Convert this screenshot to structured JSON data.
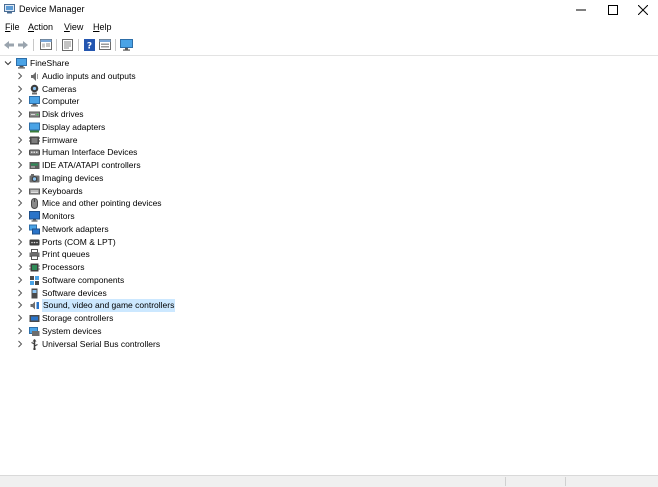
{
  "window": {
    "title": "Device Manager"
  },
  "menu": [
    {
      "label_u": "F",
      "label_rest": "ile"
    },
    {
      "label_u": "A",
      "label_rest": "ction"
    },
    {
      "label_u": "V",
      "label_rest": "iew"
    },
    {
      "label_u": "H",
      "label_rest": "elp"
    }
  ],
  "toolbar": {
    "buttons": [
      "back-arrow-icon",
      "forward-arrow-icon",
      "properties-icon",
      "update-driver-icon",
      "help-icon",
      "show-hidden-icon",
      "computer-monitor-icon"
    ]
  },
  "tree": {
    "root": {
      "label": "FineShare",
      "expanded": true
    },
    "items": [
      {
        "label": "Audio inputs and outputs",
        "icon": "speaker-icon"
      },
      {
        "label": "Cameras",
        "icon": "camera-icon"
      },
      {
        "label": "Computer",
        "icon": "computer-icon"
      },
      {
        "label": "Disk drives",
        "icon": "disk-drive-icon"
      },
      {
        "label": "Display adapters",
        "icon": "display-adapter-icon"
      },
      {
        "label": "Firmware",
        "icon": "firmware-icon"
      },
      {
        "label": "Human Interface Devices",
        "icon": "hid-icon"
      },
      {
        "label": "IDE ATA/ATAPI controllers",
        "icon": "ide-controller-icon"
      },
      {
        "label": "Imaging devices",
        "icon": "imaging-icon"
      },
      {
        "label": "Keyboards",
        "icon": "keyboard-icon"
      },
      {
        "label": "Mice and other pointing devices",
        "icon": "mouse-icon"
      },
      {
        "label": "Monitors",
        "icon": "monitor-icon"
      },
      {
        "label": "Network adapters",
        "icon": "network-adapter-icon"
      },
      {
        "label": "Ports (COM & LPT)",
        "icon": "port-icon"
      },
      {
        "label": "Print queues",
        "icon": "printer-icon"
      },
      {
        "label": "Processors",
        "icon": "processor-icon"
      },
      {
        "label": "Software components",
        "icon": "software-component-icon"
      },
      {
        "label": "Software devices",
        "icon": "software-device-icon"
      },
      {
        "label": "Sound, video and game controllers",
        "icon": "sound-controller-icon",
        "selected": true
      },
      {
        "label": "Storage controllers",
        "icon": "storage-controller-icon"
      },
      {
        "label": "System devices",
        "icon": "system-device-icon"
      },
      {
        "label": "Universal Serial Bus controllers",
        "icon": "usb-icon"
      }
    ]
  },
  "colors": {
    "selection": "#cce8ff",
    "accent": "#1e7bd6"
  }
}
